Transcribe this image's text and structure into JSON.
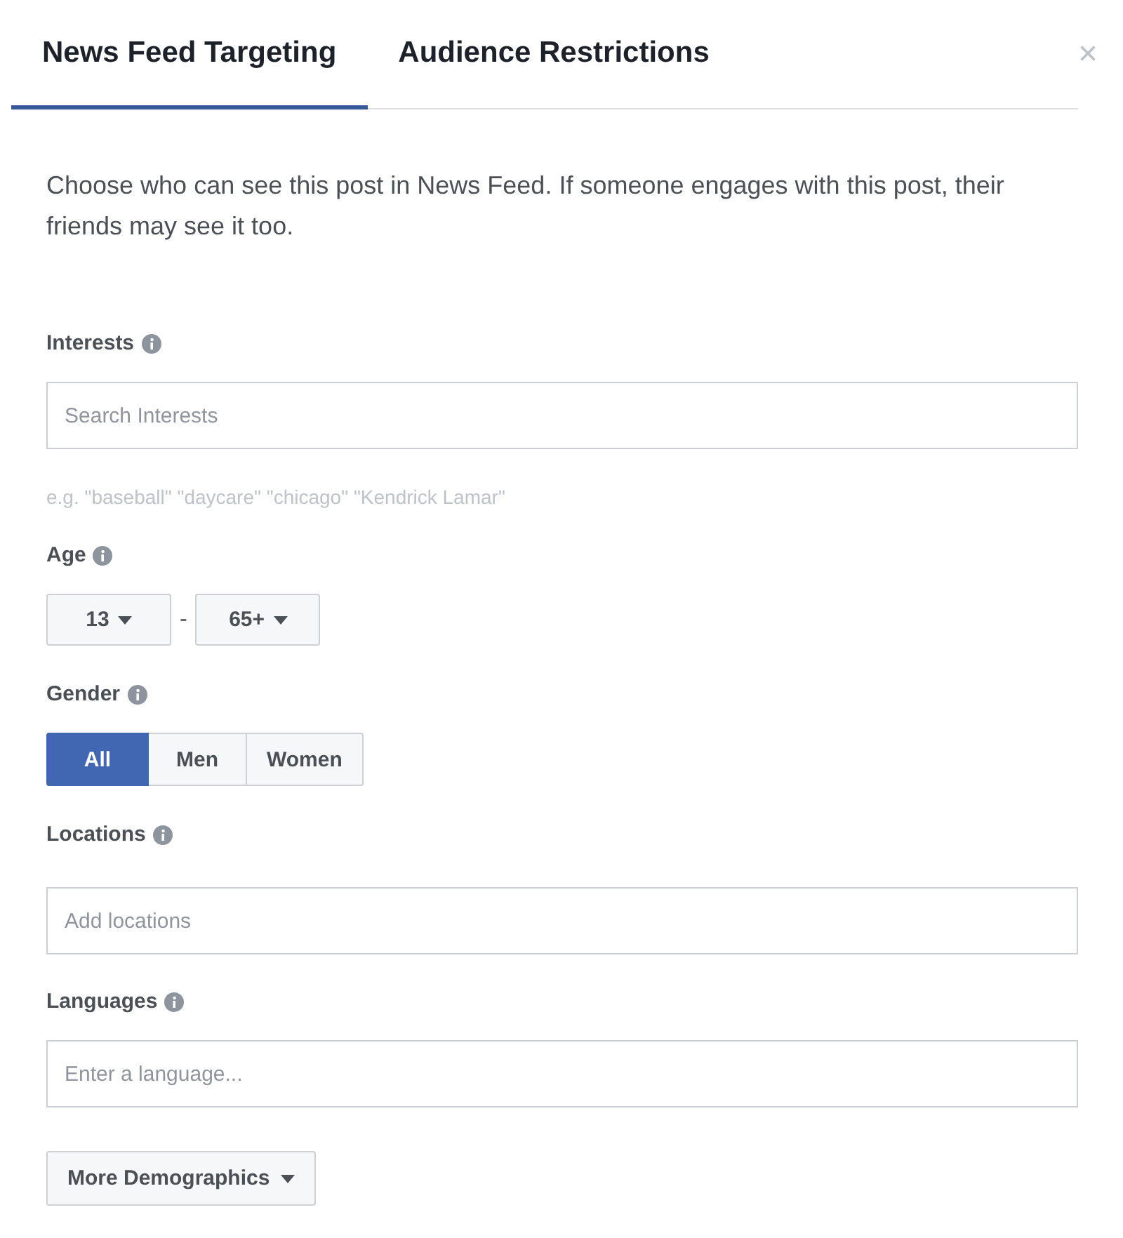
{
  "tabs": [
    {
      "label": "News Feed Targeting",
      "selected": true
    },
    {
      "label": "Audience Restrictions",
      "selected": false
    }
  ],
  "close": "×",
  "description": "Choose who can see this post in News Feed. If someone engages with this post, their friends may see it too.",
  "interests": {
    "label": "Interests",
    "placeholder": "Search Interests",
    "hint": "e.g. \"baseball\" \"daycare\" \"chicago\" \"Kendrick Lamar\""
  },
  "age": {
    "label": "Age",
    "from": "13",
    "separator": "-",
    "to": "65+"
  },
  "gender": {
    "label": "Gender",
    "options": [
      {
        "label": "All",
        "selected": true
      },
      {
        "label": "Men",
        "selected": false
      },
      {
        "label": "Women",
        "selected": false
      }
    ]
  },
  "locations": {
    "label": "Locations",
    "placeholder": "Add locations"
  },
  "languages": {
    "label": "Languages",
    "placeholder": "Enter a language..."
  },
  "more_button": "More Demographics"
}
